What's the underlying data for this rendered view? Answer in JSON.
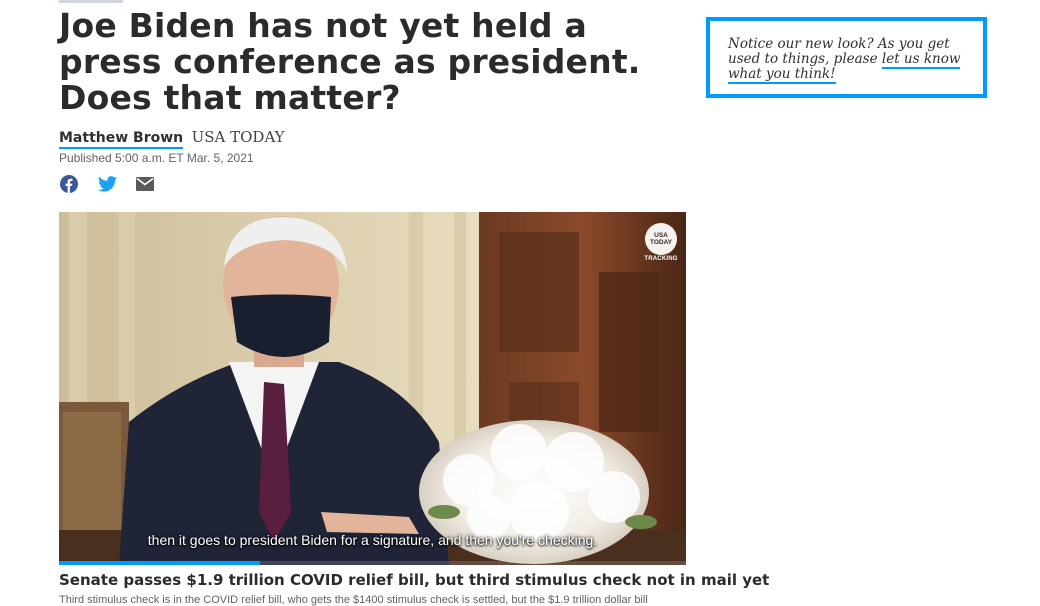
{
  "article": {
    "headline": "Joe Biden has not yet held a press conference as president. Does that matter?",
    "author": "Matthew Brown",
    "outlet": "USA TODAY",
    "published": "Published 5:00 a.m. ET Mar. 5, 2021"
  },
  "share": {
    "icons": [
      "facebook-icon",
      "twitter-icon",
      "email-icon"
    ]
  },
  "video": {
    "caption": "then it goes to president Biden for a signature, and then you're checking.",
    "badge_line1": "USA",
    "badge_line2": "TODAY",
    "badge_sub": "TRACKING",
    "progress": 0.32,
    "title": "Senate passes $1.9 trillion COVID relief bill, but third stimulus check not in mail yet",
    "description": "Third stimulus check is in the COVID relief bill, who gets the $1400 stimulus check is settled, but the $1.9 trillion dollar bill"
  },
  "notice": {
    "text_before": "Notice our new look? As you get used to things, please ",
    "link": "let us know what you think!"
  },
  "colors": {
    "accent": "#009bff",
    "facebook": "#3b5998",
    "twitter": "#1da1f2",
    "email": "#5a5a5a"
  }
}
